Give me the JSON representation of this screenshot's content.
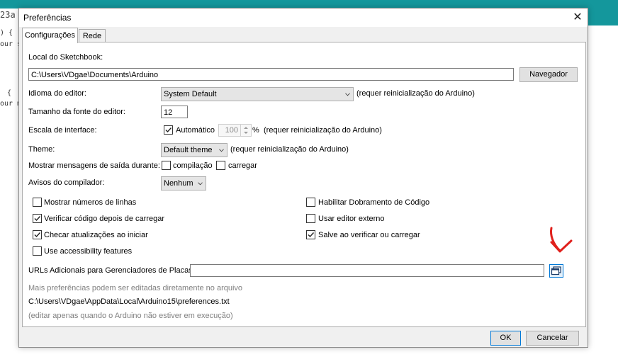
{
  "background": {
    "tab_fragment": "23a",
    "code_lines": [
      ") {",
      "our s",
      "{",
      "our m"
    ]
  },
  "dialog": {
    "title": "Preferências",
    "tabs": [
      {
        "label": "Configurações",
        "active": true
      },
      {
        "label": "Rede",
        "active": false
      }
    ],
    "sketchbook": {
      "label": "Local do Sketchbook:",
      "path": "C:\\Users\\VDgae\\Documents\\Arduino",
      "browse_label": "Navegador"
    },
    "editor_language": {
      "label": "Idioma do editor:",
      "value": "System Default",
      "note": "(requer reinicialização do Arduino)"
    },
    "font_size": {
      "label": "Tamanho da fonte do editor:",
      "value": "12"
    },
    "interface_scale": {
      "label": "Escala de interface:",
      "auto_label": "Automático",
      "auto_checked": true,
      "value": "100",
      "unit": "%",
      "note": "(requer reinicialização do Arduino)"
    },
    "theme": {
      "label": "Theme:",
      "value": "Default theme",
      "note": "(requer reinicialização do Arduino)"
    },
    "verbose_output": {
      "label": "Mostrar mensagens de saída durante:",
      "compile_label": "compilação",
      "compile_checked": false,
      "upload_label": "carregar",
      "upload_checked": false
    },
    "compiler_warnings": {
      "label": "Avisos do compilador:",
      "value": "Nenhum"
    },
    "options_left": [
      {
        "label": "Mostrar números de linhas",
        "checked": false
      },
      {
        "label": "Verificar código depois de carregar",
        "checked": true
      },
      {
        "label": "Checar atualizações ao iniciar",
        "checked": true
      },
      {
        "label": "Use accessibility features",
        "checked": false
      }
    ],
    "options_right": [
      {
        "label": "Habilitar Dobramento de Código",
        "checked": false
      },
      {
        "label": "Usar editor externo",
        "checked": false
      },
      {
        "label": "Salve ao verificar ou carregar",
        "checked": true
      }
    ],
    "board_urls": {
      "label": "URLs Adicionais para Gerenciadores de Placas:",
      "value": ""
    },
    "more_prefs_note": "Mais preferências podem ser editadas diretamente no arquivo",
    "prefs_path": "C:\\Users\\VDgae\\AppData\\Local\\Arduino15\\preferences.txt",
    "edit_note": "(editar apenas quando o Arduino não estiver em execução)",
    "ok_label": "OK",
    "cancel_label": "Cancelar"
  },
  "colors": {
    "ide_topbar": "#14979c",
    "annotation_arrow": "#e0201c",
    "focus_blue": "#0078d7"
  }
}
